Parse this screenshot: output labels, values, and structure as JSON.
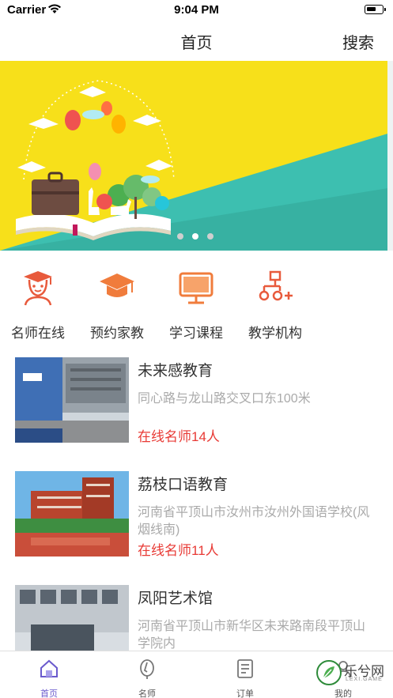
{
  "status_bar": {
    "carrier": "Carrier",
    "time": "9:04 PM"
  },
  "nav": {
    "title": "首页",
    "search": "搜索"
  },
  "banner": {
    "slide_count": 3,
    "active_slide": 2
  },
  "quick_nav": [
    {
      "label": "名师在线",
      "icon": "teacher-icon"
    },
    {
      "label": "预约家教",
      "icon": "graduation-cap-icon"
    },
    {
      "label": "学习课程",
      "icon": "monitor-icon"
    },
    {
      "label": "教学机构",
      "icon": "org-chart-icon"
    }
  ],
  "institutions": [
    {
      "name": "未来感教育",
      "address": "同心路与龙山路交叉口东100米",
      "teachers": "在线名师14人"
    },
    {
      "name": "荔枝口语教育",
      "address": "河南省平顶山市汝州市汝州外国语学校(风烟线南)",
      "teachers": "在线名师11人"
    },
    {
      "name": "凤阳艺术馆",
      "address": "河南省平顶山市新华区未来路南段平顶山学院内",
      "teachers": ""
    }
  ],
  "tab_bar": [
    {
      "label": "首页",
      "icon": "home-icon",
      "active": true
    },
    {
      "label": "名师",
      "icon": "teacher-tab-icon",
      "active": false
    },
    {
      "label": "订单",
      "icon": "order-icon",
      "active": false
    },
    {
      "label": "我的",
      "icon": "profile-icon",
      "active": false
    }
  ],
  "watermark": {
    "text": "乐兮网",
    "sub": "LEXI.GAME"
  },
  "colors": {
    "accent": "#e85a3c",
    "price_red": "#e83a35",
    "tab_active": "#6a5acd",
    "banner_yellow": "#f7e01a",
    "banner_teal": "#3dbfb0"
  }
}
